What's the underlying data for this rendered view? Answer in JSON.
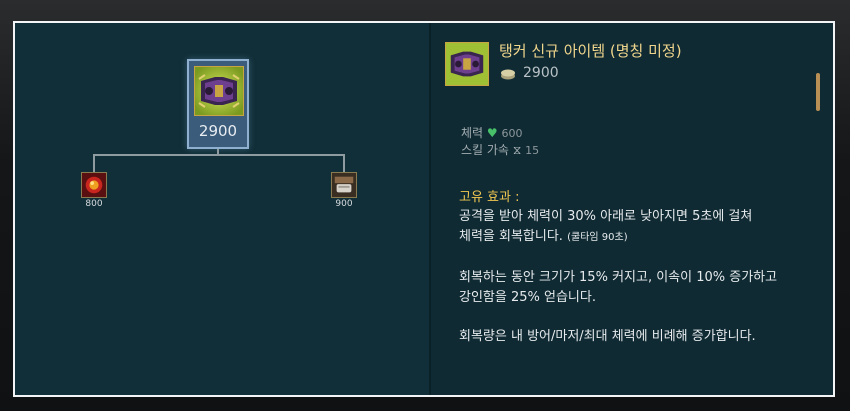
{
  "item": {
    "name": "탱커 신규 아이템 (명칭 미정)",
    "price": "2900",
    "icon": "armored-bracer-icon"
  },
  "tree": {
    "main_price": "2900",
    "components": [
      {
        "price": "800",
        "icon": "red-potion-orb-icon"
      },
      {
        "price": "900",
        "icon": "armor-plate-icon"
      }
    ]
  },
  "stats": [
    {
      "label": "체력",
      "icon": "heart-icon",
      "value": "600"
    },
    {
      "label": "스킬 가속",
      "icon": "hourglass-icon",
      "value": "15"
    }
  ],
  "passive": {
    "title": "고유 효과 :",
    "line1": "공격을 받아 체력이 30% 아래로 낮아지면 5초에 걸쳐",
    "line2_main": "체력을 회복합니다.",
    "line2_note": "(쿨타임 90초)",
    "line3": "회복하는 동안 크기가 15% 커지고, 이속이 10% 증가하고",
    "line4": "강인함을 25% 얻습니다.",
    "line5": "회복량은 내 방어/마저/최대 체력에 비례해 증가합니다."
  },
  "colors": {
    "panel": "#0f2c35",
    "title_gold": "#f0d58c",
    "passive_gold": "#f0c550",
    "heart_green": "#48c06a"
  }
}
